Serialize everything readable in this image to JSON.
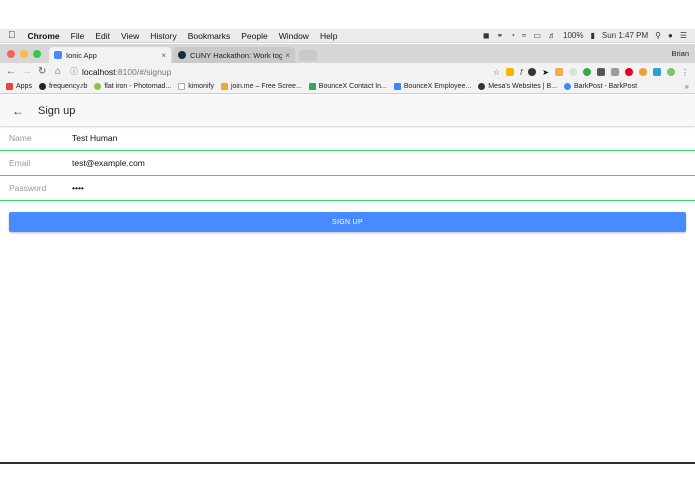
{
  "menubar": {
    "apple": "",
    "items": [
      "Chrome",
      "File",
      "Edit",
      "View",
      "History",
      "Bookmarks",
      "People",
      "Window",
      "Help"
    ],
    "battery": "100%",
    "clock": "Sun 1:47 PM"
  },
  "tabs": [
    {
      "title": "Ionic App",
      "close": "×"
    },
    {
      "title": "CUNY Hackathon: Work togeth",
      "close": "×"
    }
  ],
  "profile": "Brian",
  "address": {
    "host": "localhost",
    "path": ":8100/#/signup"
  },
  "bookmarks": [
    {
      "label": "Apps",
      "color": "#e8453c"
    },
    {
      "label": "frequency.rb",
      "color": "#222222"
    },
    {
      "label": "flat iron - Photomad...",
      "color": "#8bc34a"
    },
    {
      "label": "kimonify",
      "color": "#cccccc"
    },
    {
      "label": "join.me – Free Scree...",
      "color": "#f5a623"
    },
    {
      "label": "BounceX Contact In...",
      "color": "#34a853"
    },
    {
      "label": "BounceX Employee...",
      "color": "#4285f4"
    },
    {
      "label": "Mesa's Websites | B...",
      "color": "#333333"
    },
    {
      "label": "BarkPost - BarkPost",
      "color": "#3b8ef0"
    }
  ],
  "page": {
    "title": "Sign up",
    "fields": {
      "name_label": "Name",
      "name_value": "Test Human",
      "email_label": "Email",
      "email_value": "test@example.com",
      "password_label": "Password",
      "password_value": "••••"
    },
    "signup_label": "SIGN UP"
  },
  "colors": {
    "accent": "#488aff",
    "field_underline": "#32db64"
  }
}
